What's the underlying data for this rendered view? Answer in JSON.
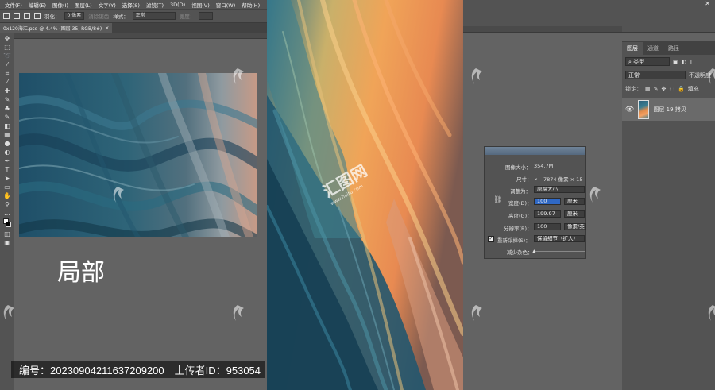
{
  "menubar": {
    "items": [
      "文件(F)",
      "编辑(E)",
      "图像(I)",
      "图层(L)",
      "文字(Y)",
      "选择(S)",
      "滤镜(T)",
      "3D(D)",
      "视图(V)",
      "窗口(W)",
      "帮助(H)"
    ]
  },
  "options": {
    "feather_label": "羽化：",
    "feather_value": "0 像素",
    "antialias_label": "消除锯齿",
    "style_label": "样式：",
    "style_value": "正常",
    "width_label": "宽度："
  },
  "document": {
    "tab_title": "0x120海汇.psd @ 4.4% (图层 35, RGB/8#)",
    "close_glyph": "×"
  },
  "left_canvas": {
    "label": "局部",
    "caption": "编号：20230904211637209200　上传者ID：953054"
  },
  "layers_panel": {
    "tabs": [
      "图层",
      "通道",
      "路径"
    ],
    "filter_kind": "类型",
    "blend_mode": "正常",
    "opacity_label": "不透明度",
    "lock_label": "锁定：",
    "fill_label": "填充",
    "layer_name": "图层 19 拷贝"
  },
  "image_size_dialog": {
    "image_size_label": "图像大小：",
    "image_size_value": "354.7M",
    "dimensions_label": "尺寸：",
    "dimensions_value": "7874 像素 × 15",
    "fit_to_label": "调整为：",
    "fit_to_value": "原稿大小",
    "width_label": "宽度(D)：",
    "width_value": "100",
    "width_unit": "厘米",
    "height_label": "高度(G)：",
    "height_value": "199.97",
    "height_unit": "厘米",
    "resolution_label": "分辨率(R)：",
    "resolution_value": "100",
    "resolution_unit": "像素/英",
    "resample_label": "重新采样(S)：",
    "resample_value": "保留细节（扩大）",
    "noise_label": "减少杂色："
  },
  "watermark": {
    "text": "汇图网",
    "url": "www.huitu.com"
  },
  "colors": {
    "ui_dark": "#535353",
    "canvas_bg": "#636363",
    "selection_blue": "#2f68c4"
  }
}
